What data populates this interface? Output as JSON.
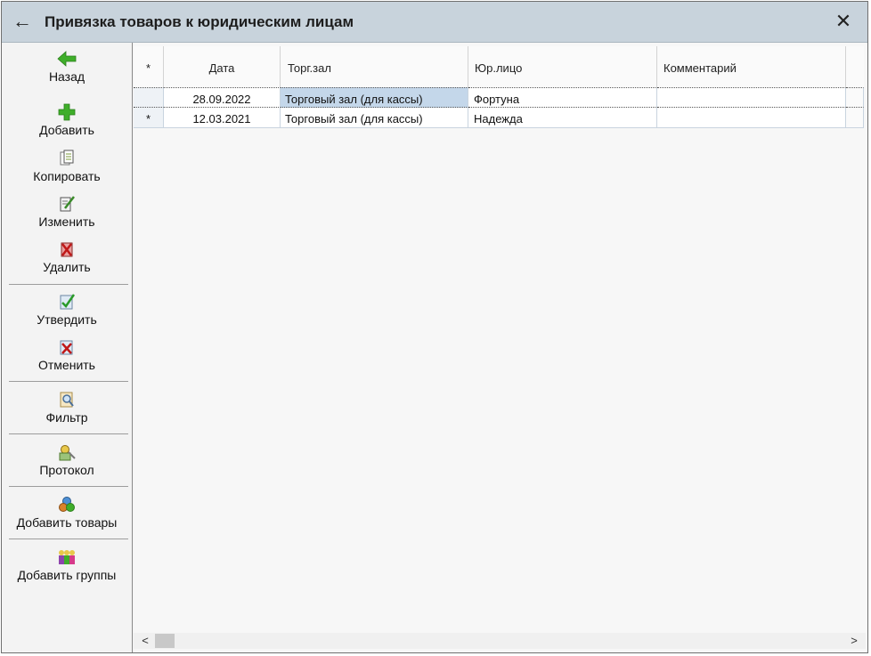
{
  "window": {
    "title": "Привязка товаров к юридическим лицам",
    "back_icon": "←",
    "close_icon": "✕"
  },
  "toolbar": {
    "back": "Назад",
    "add": "Добавить",
    "copy": "Копировать",
    "edit": "Изменить",
    "delete": "Удалить",
    "approve": "Утвердить",
    "cancel": "Отменить",
    "filter": "Фильтр",
    "log": "Протокол",
    "add_goods": "Добавить товары",
    "add_groups": "Добавить группы"
  },
  "table": {
    "columns": [
      "*",
      "Дата",
      "Торг.зал",
      "Юр.лицо",
      "Комментарий"
    ],
    "rows": [
      {
        "marker": "",
        "date": "28.09.2022",
        "hall": "Торговый зал (для кассы)",
        "entity": "Фортуна",
        "comment": ""
      },
      {
        "marker": "*",
        "date": "12.03.2021",
        "hall": "Торговый зал (для кассы)",
        "entity": "Надежда",
        "comment": ""
      }
    ]
  },
  "scroll": {
    "left": "<",
    "right": ">"
  }
}
